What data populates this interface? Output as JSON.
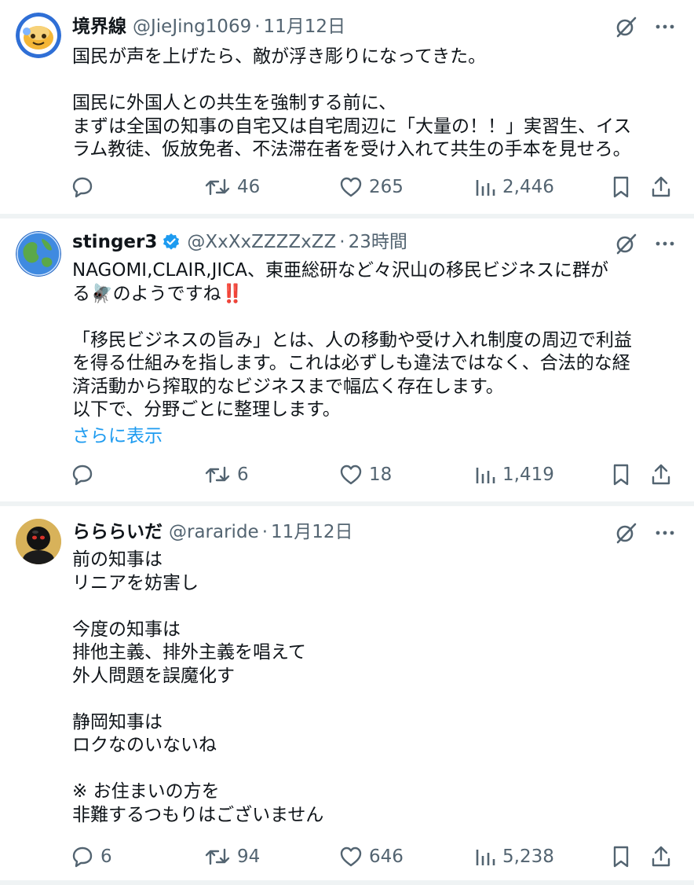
{
  "tweets": [
    {
      "name": "境界線",
      "handle": "@JieJing1069",
      "dot": "·",
      "time": "11月12日",
      "avatar_icon": "cartoon-face-avatar",
      "text": "国民が声を上げたら、敵が浮き彫りになってきた。\n\n国民に外国人との共生を強制する前に、\nまずは全国の知事の自宅又は自宅周辺に「大量の！！」実習生、イス\nラム教徒、仮放免者、不法滞在者を受け入れて共生の手本を見せろ。",
      "replies": "",
      "retweets": "46",
      "likes": "265",
      "views": "2,446"
    },
    {
      "name": "stinger3",
      "verified": true,
      "handle": "@XxXxZZZZxZZ",
      "dot": "·",
      "time": "23時間",
      "avatar_icon": "globe-avatar",
      "text": "NAGOMI,CLAIR,JICA、東亜総研など々沢山の移民ビジネスに群が\nる🪰のようですね‼️\n\n「移民ビジネスの旨み」とは、人の移動や受け入れ制度の周辺で利益\nを得る仕組みを指します。これは必ずしも違法ではなく、合法的な経\n済活動から搾取的なビジネスまで幅広く存在します。\n以下で、分野ごとに整理します。",
      "show_more": "さらに表示",
      "replies": "",
      "retweets": "6",
      "likes": "18",
      "views": "1,419"
    },
    {
      "name": "らららいだ",
      "handle": "@rararide",
      "dot": "·",
      "time": "11月12日",
      "avatar_icon": "helmet-figure-avatar",
      "text": "前の知事は\nリニアを妨害し\n\n今度の知事は\n排他主義、排外主義を唱えて\n外人問題を誤魔化す\n\n静岡知事は\nロクなのいないね\n\n※ お住まいの方を\n非難するつもりはございません",
      "replies": "6",
      "retweets": "94",
      "likes": "646",
      "views": "5,238"
    }
  ],
  "icons": {
    "grok": "grok-icon",
    "more": "more-options-icon",
    "reply": "reply-icon",
    "retweet": "retweet-icon",
    "like": "like-icon",
    "views": "views-icon",
    "bookmark": "bookmark-icon",
    "share": "share-icon",
    "verified": "verified-badge-icon"
  },
  "colors": {
    "text": "#0f1419",
    "secondary": "#536471",
    "link": "#1d9bf0",
    "verified": "#1d9bf0",
    "divider": "#eff3f4"
  }
}
